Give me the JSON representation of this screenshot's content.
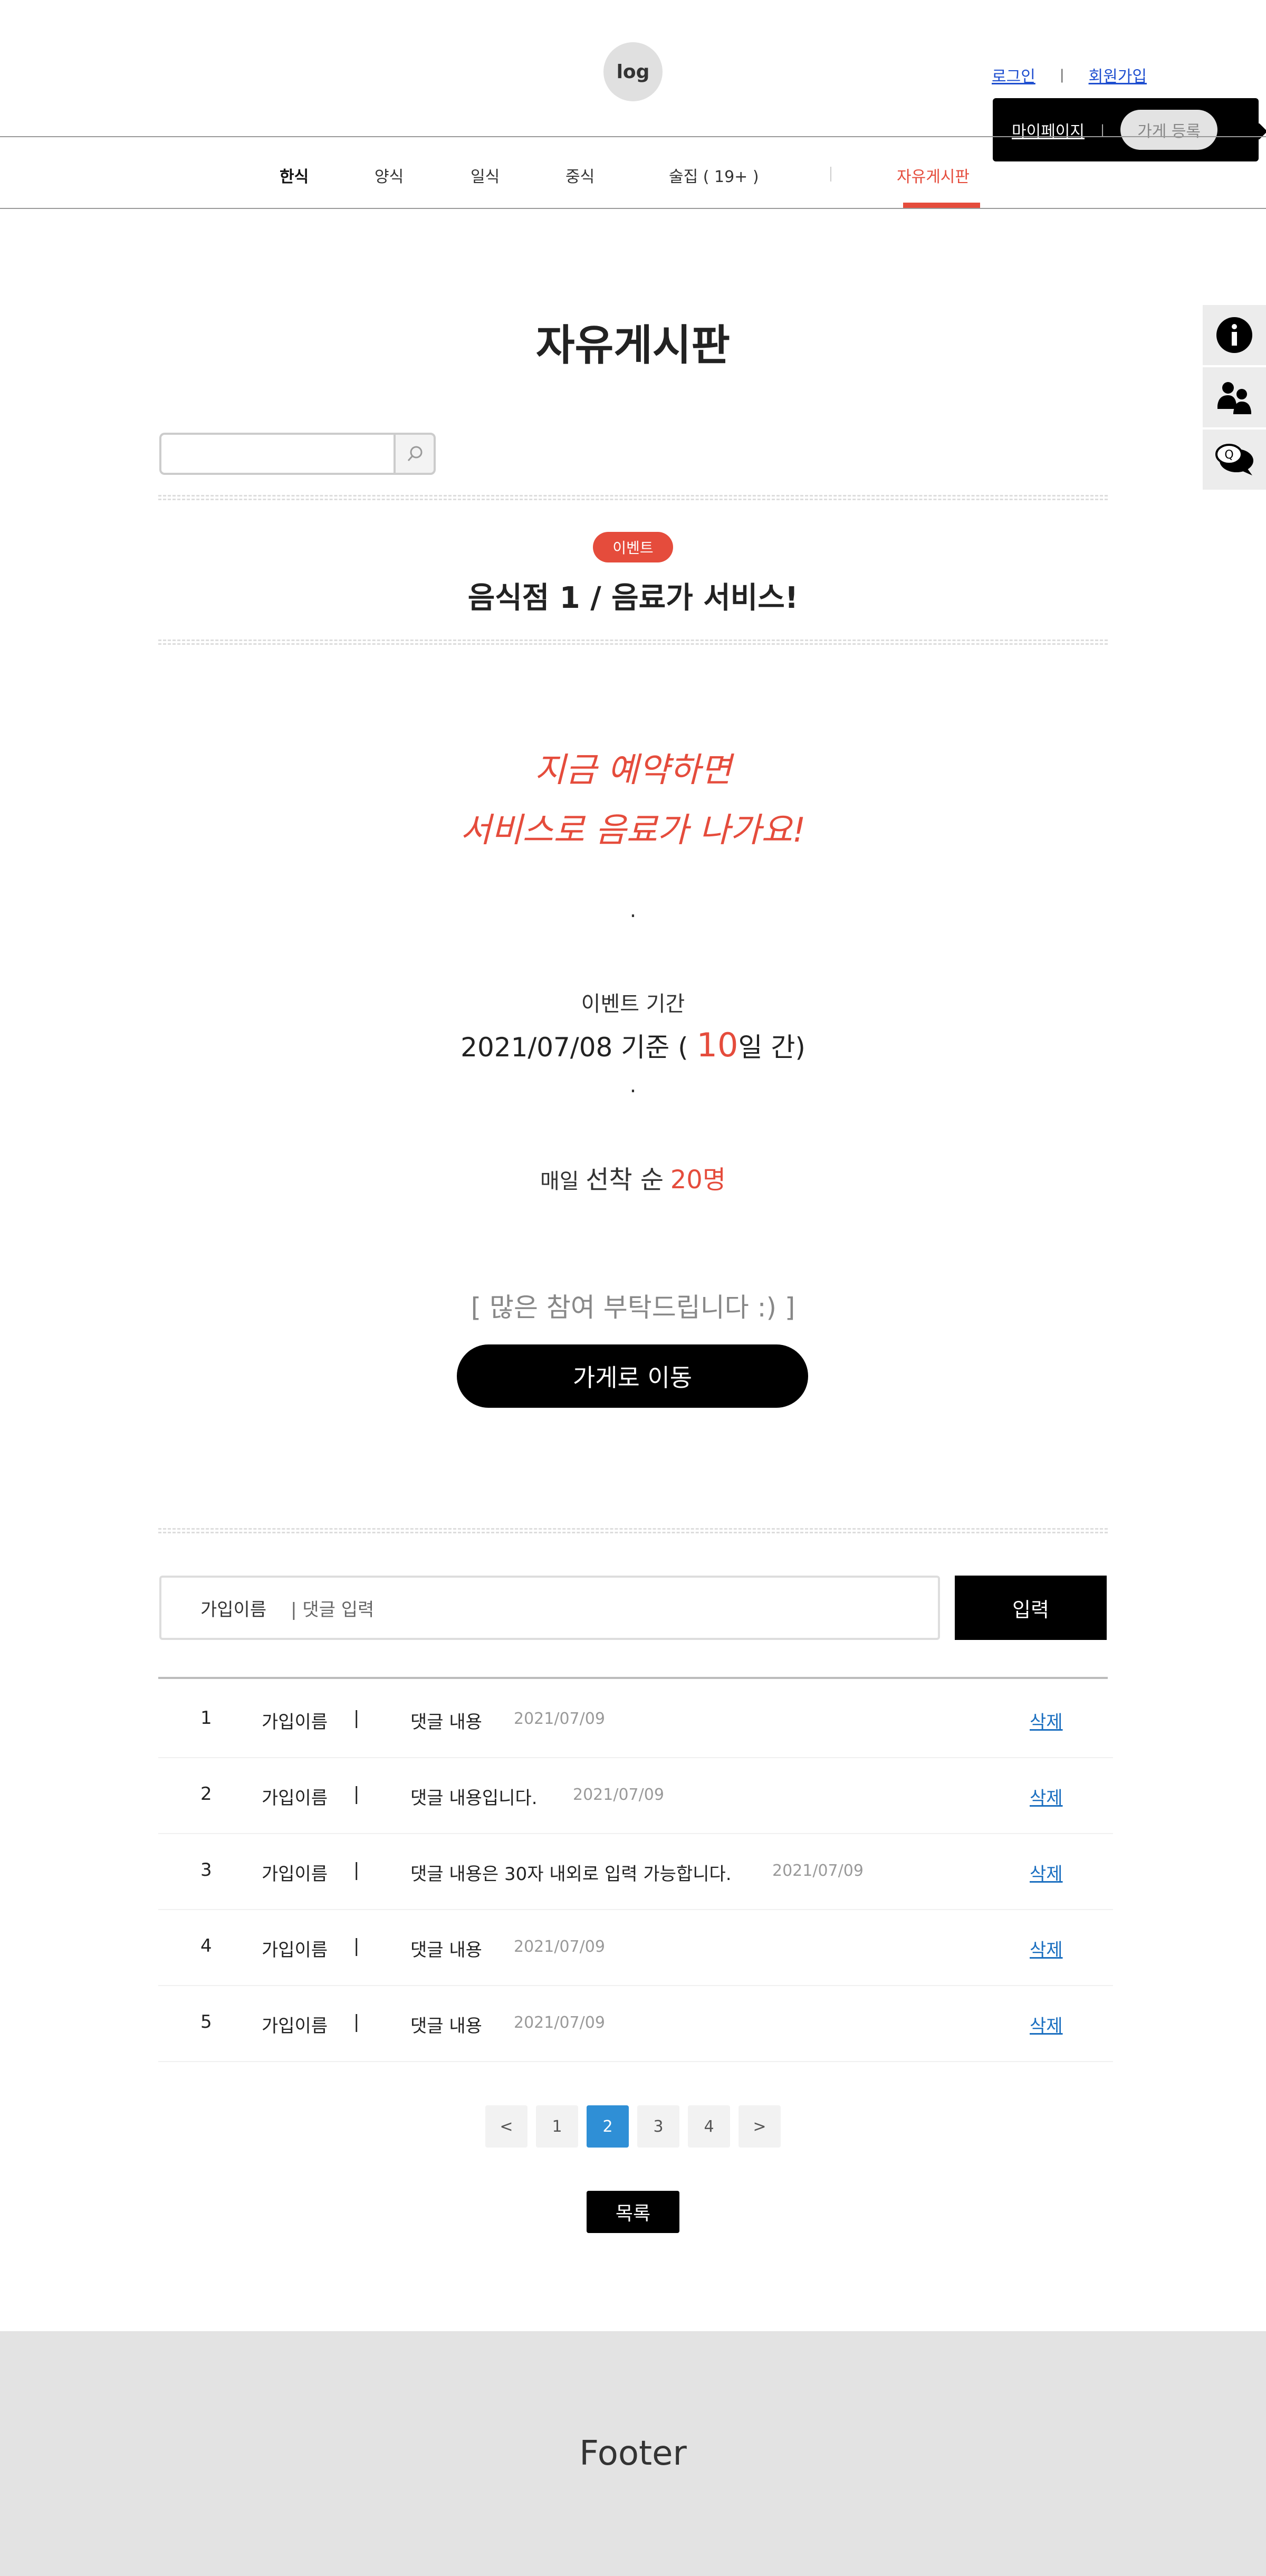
{
  "header": {
    "logo": "log",
    "login": "로그인",
    "signup": "회원가입",
    "separator": "|",
    "popup": {
      "mypage": "마이페이지",
      "separator": "|",
      "store_register": "가게 등록"
    }
  },
  "nav": {
    "items": [
      "한식",
      "양식",
      "일식",
      "중식",
      "술집 ( 19+ )"
    ],
    "separator": "|",
    "active": "자유게시판"
  },
  "side_bar": {
    "icons": [
      "info-icon",
      "users-icon",
      "qa-chat-icon"
    ],
    "qa_letter": "Q"
  },
  "page_title": "자유게시판",
  "search": {
    "value": "",
    "placeholder": ""
  },
  "post": {
    "badge": "이벤트",
    "title": "음식점 1 / 음료가 서비스!",
    "promo_line1": "지금 예약하면",
    "promo_line2": "서비스로 음료가 나가요!",
    "dot": ".",
    "period_label": "이벤트 기간",
    "period_prefix": "2021/07/08 기준 (",
    "period_days": "10",
    "period_suffix": "일 간)",
    "daily_prefix": "매일",
    "daily_mid": "선착 순",
    "daily_count": "20명",
    "closing": "[ 많은 참여 부탁드립니다 :) ]",
    "cta": "가게로 이동"
  },
  "comment_form": {
    "author": "가입이름",
    "divider": "|",
    "placeholder": "댓글 입력",
    "submit": "입력"
  },
  "comments": [
    {
      "num": "1",
      "author": "가입이름",
      "bar": "|",
      "content": "댓글 내용",
      "date": "2021/07/09",
      "delete": "삭제"
    },
    {
      "num": "2",
      "author": "가입이름",
      "bar": "|",
      "content": "댓글 내용입니다.",
      "date": "2021/07/09",
      "delete": "삭제"
    },
    {
      "num": "3",
      "author": "가입이름",
      "bar": "|",
      "content": "댓글 내용은 30자 내외로 입력 가능합니다.",
      "date": "2021/07/09",
      "delete": "삭제"
    },
    {
      "num": "4",
      "author": "가입이름",
      "bar": "|",
      "content": "댓글 내용",
      "date": "2021/07/09",
      "delete": "삭제"
    },
    {
      "num": "5",
      "author": "가입이름",
      "bar": "|",
      "content": "댓글 내용",
      "date": "2021/07/09",
      "delete": "삭제"
    }
  ],
  "pagination": {
    "prev": "<",
    "pages": [
      "1",
      "2",
      "3",
      "4"
    ],
    "current": "2",
    "next": ">"
  },
  "list_button": "목록",
  "footer": "Footer",
  "colors": {
    "accent": "#e54c3c",
    "link": "#1f4fd0",
    "page_active": "#2f8fd6"
  }
}
